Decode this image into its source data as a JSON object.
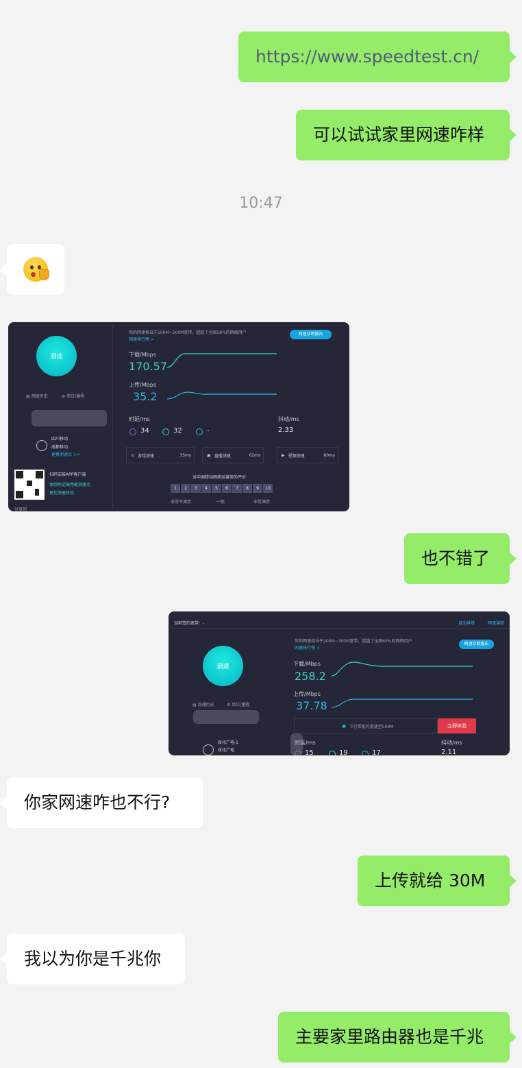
{
  "messages": {
    "m1": "https://www.speedtest.cn/",
    "m2": "可以试试家里网速咋样",
    "time": "10:47",
    "m3": "也不错了",
    "m4": "你家网速咋也不行?",
    "m5": "上传就给 30M",
    "m6": "我以为你是千兆你",
    "m7": "主要家里路由器也是千兆"
  },
  "shot1": {
    "ball": "测速",
    "history": "测速历史",
    "unit": "单位/量程",
    "isp_line1": "四川移动",
    "isp_line2": "成都移动",
    "change_node": "更换测速点 >>",
    "scan_title": "扫码安装APP客户端",
    "scan_l1": "体验附近高性能测速点",
    "scan_l2": "更优测速体验",
    "share": "分享到",
    "summary": "你的网速相当于100M~200M宽带，超越了全国58%的网络用户",
    "rank_link": "网速排行榜 >",
    "report_btn": "网速诊断报告",
    "dl_label": "下载/Mbps",
    "dl_value": "170.57",
    "ul_label": "上传/Mbps",
    "ul_value": "35.2",
    "latency_label": "时延/ms",
    "jitter_label": "抖动/ms",
    "lat1": "34",
    "lat2": "32",
    "lat3": "-",
    "jitter": "2.33",
    "card_game": "游戏测速",
    "card_game_ms": "35ms",
    "card_live": "直播测速",
    "card_live_ms": "62ms",
    "card_video": "视频测速",
    "card_video_ms": "80ms",
    "rate_title": "对中国移动网络运营商的评价",
    "rating": [
      "1",
      "2",
      "3",
      "4",
      "5",
      "6",
      "7",
      "8",
      "9",
      "10"
    ],
    "rate_low": "非常不满意",
    "rate_mid": "一般",
    "rate_high": "非常满意"
  },
  "shot2": {
    "top_left": "当前签约宽带：-",
    "top_r1": "自助排障",
    "top_r2": "网速课堂",
    "ball": "测速",
    "history": "测速历史",
    "unit": "单位/量程",
    "isp_line1": "绥化广电-1",
    "isp_line2": "绥化广电",
    "summary": "你的网速相当于200M~300M宽带，超越了全国65%的网络用户",
    "rank_link": "网速排行榜 >",
    "report_btn": "网速诊断报告",
    "dl_label": "下载/Mbps",
    "dl_value": "258.2",
    "ul_label": "上传/Mbps",
    "ul_value": "37.78",
    "upgrade_text": "下行带宽可提速至500M",
    "upgrade_btn": "立即体验",
    "latency_label": "时延/ms",
    "jitter_label": "抖动/ms",
    "lat1": "15",
    "lat2": "19",
    "lat3": "17",
    "jitter": "2.11"
  }
}
